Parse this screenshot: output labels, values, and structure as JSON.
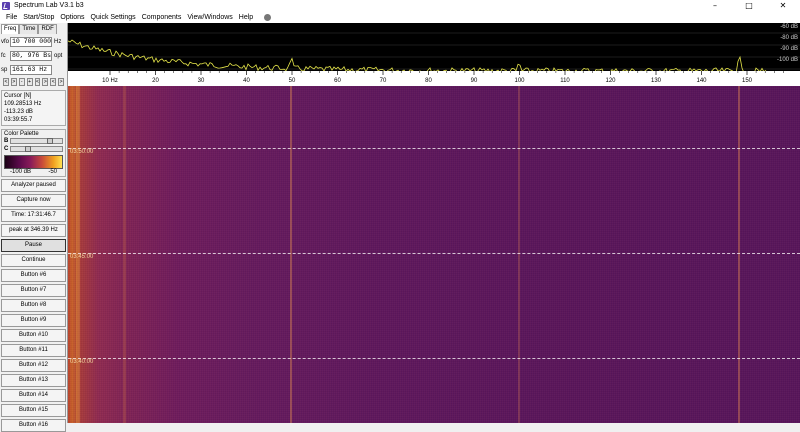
{
  "window": {
    "title": "Spectrum Lab V3.1 b3",
    "controls": [
      "–",
      "□",
      "✕"
    ]
  },
  "menu": [
    "File",
    "Start/Stop",
    "Options",
    "Quick Settings",
    "Components",
    "View/Windows",
    "Help"
  ],
  "tabs": [
    "Freq",
    "Time",
    "RDF"
  ],
  "fields": {
    "vfo_label": "vfo",
    "vfo_value": "10 700 000",
    "vfo_unit": "Hz",
    "fc_label": "fc",
    "fc_value": "80, 976 Bs",
    "fc_unit": "opt",
    "sp_label": "sp",
    "sp_value": "161.63 Hz"
  },
  "arrow_buttons": [
    "<",
    ">",
    "-",
    "+",
    "<",
    ">",
    "<",
    ">"
  ],
  "cursor": {
    "header": "Cursor [N]",
    "freq": "109.28513 Hz",
    "level": "-113.23 dB",
    "time": "03:39:55.7"
  },
  "palette": {
    "header": "Color Palette",
    "b_label": "B",
    "c_label": "C",
    "min": "-100 dB",
    "max": "-50"
  },
  "buttons": {
    "analyzer": "Analyzer paused",
    "capture": "Capture now",
    "time": "Time:  17:31:46.7",
    "peak": "peak at 346.39 Hz",
    "pause": "Pause",
    "continue": "Continue",
    "numbered": [
      "Button #6",
      "Button #7",
      "Button #8",
      "Button #9",
      "Button #10",
      "Button #11",
      "Button #12",
      "Button #13",
      "Button #14",
      "Button #15",
      "Button #16"
    ]
  },
  "spectrum": {
    "db_labels": [
      "-60 dB",
      "-80 dB",
      "-90 dB",
      "-100 dB"
    ],
    "freq_labels": [
      "10  Hz",
      "20",
      "30",
      "40",
      "50",
      "60",
      "70",
      "80",
      "90",
      "100",
      "110",
      "120",
      "130",
      "140",
      "150"
    ]
  },
  "waterfall": {
    "time_labels": [
      "03:50:00",
      "03:45:00",
      "03:40:00"
    ]
  },
  "colors": {
    "trace": "#e6e64a",
    "grid": "#3a3a3a"
  }
}
